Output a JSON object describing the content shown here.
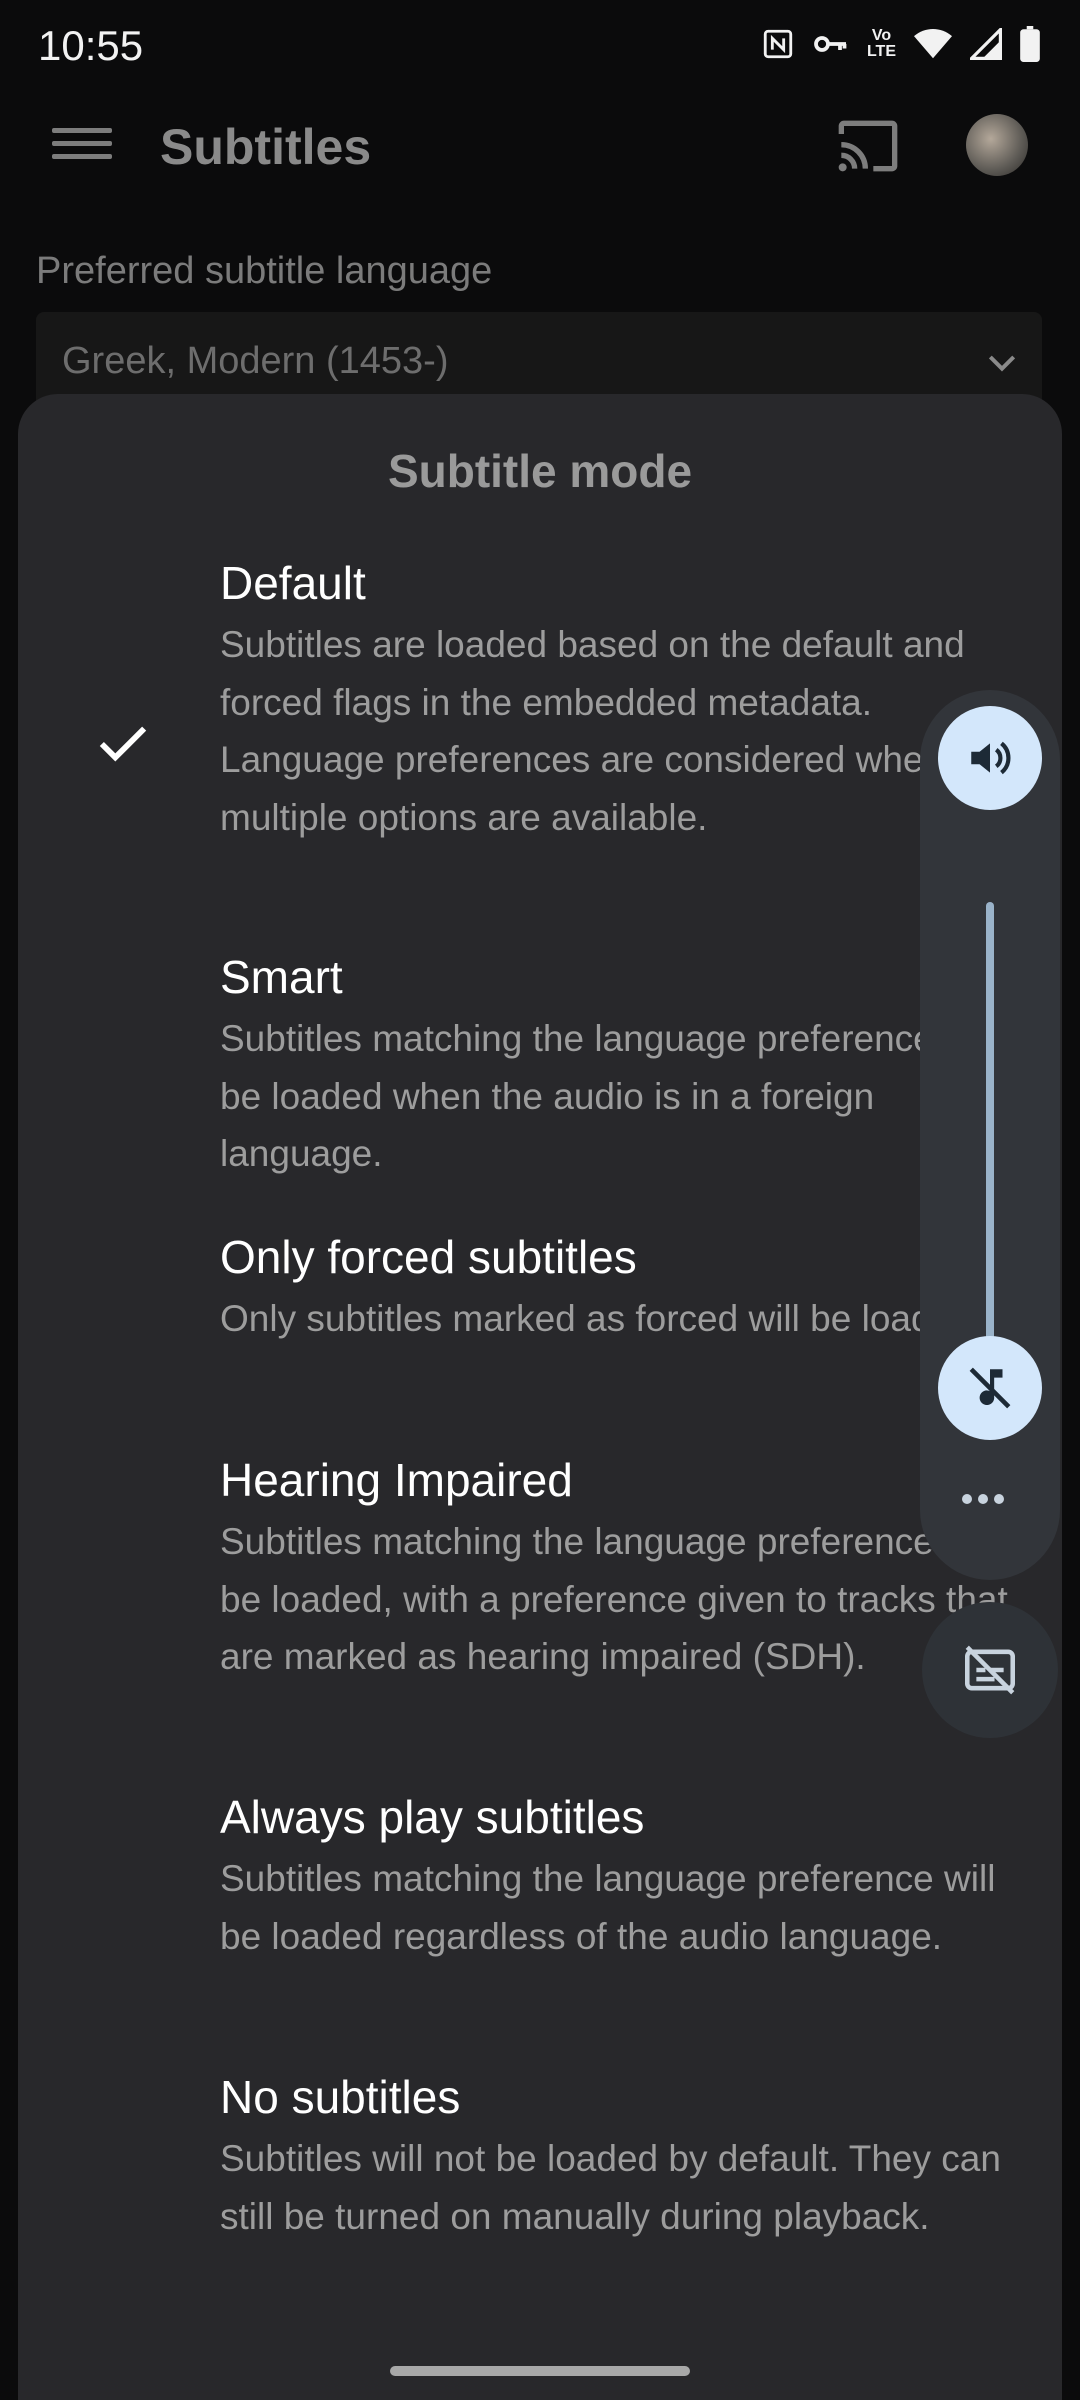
{
  "status_bar": {
    "time": "10:55",
    "icons": [
      "nfc-icon",
      "vpn-key-icon",
      "volte-icon",
      "wifi-icon",
      "signal-icon",
      "battery-icon"
    ],
    "volte_top": "Vo",
    "volte_bottom": "LTE"
  },
  "app_bar": {
    "title": "Subtitles",
    "icons": [
      "menu-icon",
      "cast-icon",
      "avatar"
    ]
  },
  "preference": {
    "label": "Preferred subtitle language",
    "value": "Greek, Modern (1453-)"
  },
  "sheet": {
    "title": "Subtitle mode",
    "selected_index": 0,
    "options": [
      {
        "title": "Default",
        "description": "Subtitles are loaded based on the default and forced flags in the embedded metadata. Language preferences are considered when multiple options are available."
      },
      {
        "title": "Smart",
        "description": "Subtitles matching the language preference will be loaded when the audio is in a foreign language."
      },
      {
        "title": "Only forced subtitles",
        "description": "Only subtitles marked as forced will be loaded."
      },
      {
        "title": "Hearing Impaired",
        "description": "Subtitles matching the language preference will be loaded, with a preference given to tracks that are marked as hearing impaired (SDH)."
      },
      {
        "title": "Always play subtitles",
        "description": "Subtitles matching the language preference will be loaded regardless of the audio language."
      },
      {
        "title": "No subtitles",
        "description": "Subtitles will not be loaded by default. They can still be turned on manually during playback."
      }
    ]
  },
  "volume_panel": {
    "level": 0,
    "icons": [
      "speaker-icon",
      "music-off-icon",
      "more-horiz-icon",
      "captions-off-icon"
    ]
  },
  "colors": {
    "background": "#0b0b0c",
    "sheet": "#28282b",
    "volume_accent": "#d3e7fb"
  }
}
